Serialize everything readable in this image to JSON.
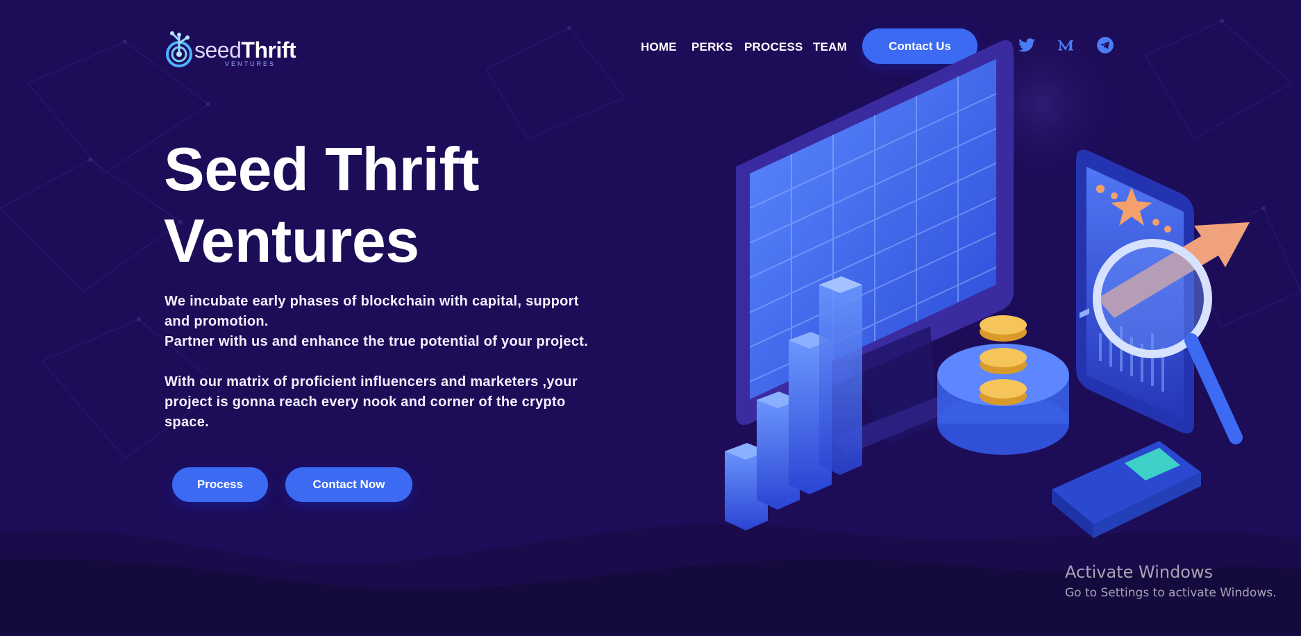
{
  "brand": {
    "name_light": "seed",
    "name_bold": "Thrift",
    "tagline": "VENTURES",
    "logo_icon": "seed-target-icon"
  },
  "nav": {
    "items": [
      "HOME",
      "PERKS",
      "PROCESS",
      "TEAM"
    ],
    "cta_label": "Contact Us"
  },
  "social": [
    {
      "name": "twitter-icon"
    },
    {
      "name": "medium-icon"
    },
    {
      "name": "telegram-icon"
    }
  ],
  "hero": {
    "title_line1": "Seed Thrift",
    "title_line2": "Ventures",
    "paragraph1_line1": "We incubate early phases of blockchain with capital, support",
    "paragraph1_line2": "and promotion.",
    "paragraph1_line3": "Partner with us and enhance the true potential of your project.",
    "paragraph2_line1": "With our matrix of proficient influencers and marketers ,your",
    "paragraph2_line2": "project is gonna reach every nook and corner of the crypto",
    "paragraph2_line3": "space.",
    "button_process": "Process",
    "button_contact": "Contact Now"
  },
  "illustration": {
    "elements": [
      "monitor-icon",
      "bar-chart-icon",
      "coin-stack-icon",
      "smartphone-icon",
      "magnifier-icon",
      "arrow-up-icon",
      "calculator-icon"
    ]
  },
  "overlay": {
    "activate_title": "Activate Windows",
    "activate_sub": "Go to Settings to activate Windows."
  },
  "colors": {
    "background": "#1d0c58",
    "accent": "#3c6af2",
    "wave": "#150a3d",
    "coin": "#f5c45a"
  }
}
